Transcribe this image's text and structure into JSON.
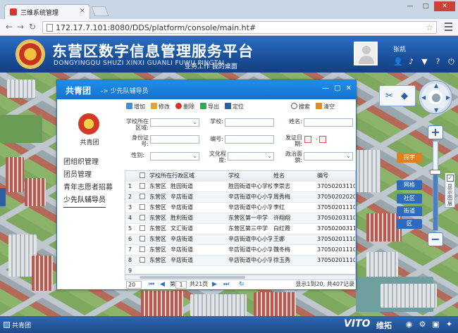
{
  "browser": {
    "tab_title": "三维系统管理",
    "url": "172.17.7.101:8080/DDS/platform/console/main.ht#"
  },
  "header": {
    "title": "东营区数字信息管理服务平台",
    "subtitle": "DONGYINGQU SHUZI XINXI GUANLI FUWU PINGTAI",
    "links": "业务工作  我的桌面",
    "user": "张凯"
  },
  "dialog": {
    "title": "共青团",
    "breadcrumb": "-> 少先队辅导员",
    "side_caption": "共青团",
    "nav": [
      "团组织管理",
      "团员管理",
      "青年志愿者招募",
      "少先队辅导员"
    ],
    "toolbar": {
      "add": "增加",
      "edit": "修改",
      "delete": "删除",
      "export": "导出",
      "locate": "定位",
      "search": "搜索",
      "clear": "清空"
    },
    "form": {
      "region_label": "学校所在区域:",
      "school_label": "学校:",
      "name_label": "姓名:",
      "id_label": "身份证号:",
      "code_label": "编号:",
      "date_label": "发证日期:",
      "gender_label": "性别:",
      "edu_label": "文化程度:",
      "political_label": "政治面貌:",
      "date_sep": "-"
    },
    "grid": {
      "columns": [
        "",
        "学校所在行政区域",
        "学校",
        "姓名",
        "编号"
      ],
      "rows": [
        {
          "n": "1",
          "district": "东营区",
          "street": "胜园街道",
          "school": "胜园街道中心学校",
          "name": "李崇志",
          "code": "370502031100"
        },
        {
          "n": "2",
          "district": "东营区",
          "street": "辛店街道",
          "school": "辛店街道中心小学",
          "name": "周秀梅",
          "code": "370502020200"
        },
        {
          "n": "3",
          "district": "东营区",
          "street": "辛店街道",
          "school": "辛店街道中心小学",
          "name": "李红",
          "code": "370502011102"
        },
        {
          "n": "4",
          "district": "东营区",
          "street": "胜利街道",
          "school": "东营区第一中学",
          "name": "许翔翔",
          "code": "370502031101"
        },
        {
          "n": "5",
          "district": "东营区",
          "street": "文汇街道",
          "school": "东营区第三中学",
          "name": "白红霞",
          "code": "370502003110"
        },
        {
          "n": "6",
          "district": "东营区",
          "street": "辛店街道",
          "school": "辛店街道中心小学",
          "name": "王娜",
          "code": "370502011101"
        },
        {
          "n": "7",
          "district": "东营区",
          "street": "辛店街道",
          "school": "辛店街道中心小学",
          "name": "魏冬梅",
          "code": "370502011102"
        },
        {
          "n": "8",
          "district": "东营区",
          "street": "辛店街道",
          "school": "辛店街道中心小学",
          "name": "徐玉秀",
          "code": "370502011101"
        },
        {
          "n": "9",
          "district": "",
          "street": "",
          "school": "",
          "name": "",
          "code": ""
        }
      ]
    },
    "pager": {
      "page_size": "20",
      "page_prefix": "第",
      "page": "1",
      "page_total": "共21页",
      "summary": "显示1到20, 共407记录"
    }
  },
  "map": {
    "labels": [
      "探宇",
      "网格",
      "社区",
      "街道",
      "区"
    ],
    "show_layer": "显示图层"
  },
  "taskbar": {
    "start": "共青团",
    "brand": "VITO",
    "brand_cn": "维拓"
  },
  "colors": {
    "accent": "#1f8ee8",
    "header": "#1a4f9a"
  }
}
